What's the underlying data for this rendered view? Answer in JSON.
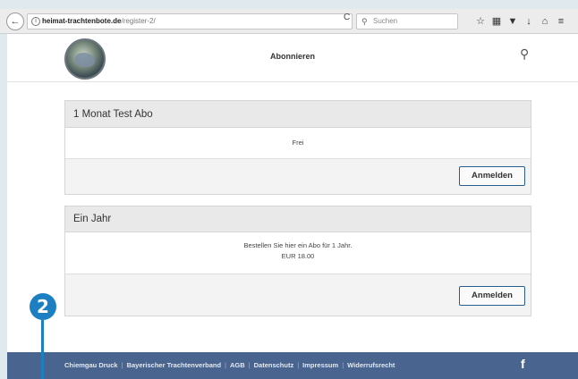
{
  "browser": {
    "url_host": "heimat-trachtenbote.de",
    "url_path": "/register-2/",
    "search_placeholder": "Suchen",
    "back_glyph": "←",
    "reload_glyph": "C",
    "info_glyph": "i",
    "toolbar_icons": [
      "star-icon",
      "reader-icon",
      "pocket-icon",
      "download-icon",
      "home-icon",
      "menu-icon"
    ]
  },
  "header": {
    "title": "Abonnieren",
    "search_icon": "search-icon"
  },
  "plans": [
    {
      "title": "1 Monat Test Abo",
      "description": "Frei",
      "price": "",
      "button_label": "Anmelden"
    },
    {
      "title": "Ein Jahr",
      "description": "Bestellen Sie hier ein Abo für 1 Jahr.",
      "price": "EUR 18.00",
      "button_label": "Anmelden"
    }
  ],
  "footer": {
    "links": [
      "Chiemgau Druck",
      "Bayerischer Trachtenverband",
      "AGB",
      "Datenschutz",
      "Impressum",
      "Widerrufsrecht"
    ],
    "social_icon": "facebook-icon",
    "social_glyph": "f"
  },
  "callout": {
    "number": "2",
    "color": "#1b7fc1"
  },
  "colors": {
    "footer_bg": "#49648e",
    "button_border": "#2a5d8f"
  }
}
